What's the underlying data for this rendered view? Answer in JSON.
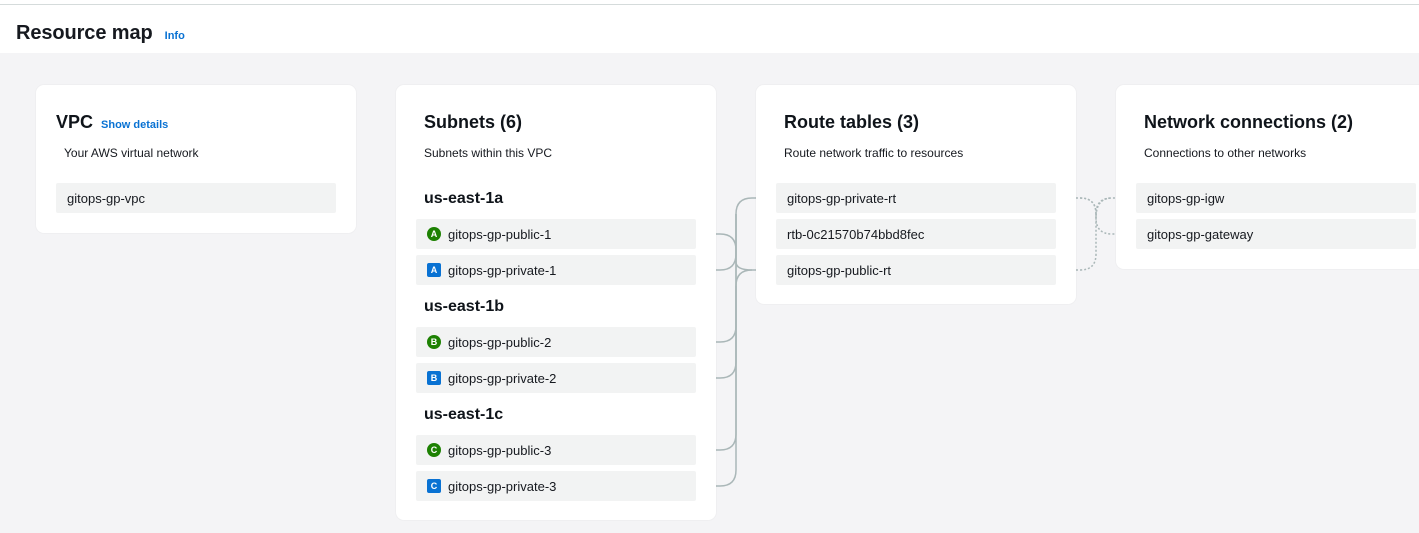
{
  "header": {
    "title": "Resource map",
    "info_label": "Info"
  },
  "vpc": {
    "title": "VPC",
    "show_details": "Show details",
    "description": "Your AWS virtual network",
    "item": "gitops-gp-vpc"
  },
  "subnets": {
    "title": "Subnets (6)",
    "description": "Subnets within this VPC",
    "zones": [
      {
        "label": "us-east-1a",
        "public": {
          "badge": "A",
          "name": "gitops-gp-public-1"
        },
        "private": {
          "badge": "A",
          "name": "gitops-gp-private-1"
        }
      },
      {
        "label": "us-east-1b",
        "public": {
          "badge": "B",
          "name": "gitops-gp-public-2"
        },
        "private": {
          "badge": "B",
          "name": "gitops-gp-private-2"
        }
      },
      {
        "label": "us-east-1c",
        "public": {
          "badge": "C",
          "name": "gitops-gp-public-3"
        },
        "private": {
          "badge": "C",
          "name": "gitops-gp-private-3"
        }
      }
    ]
  },
  "route_tables": {
    "title": "Route tables (3)",
    "description": "Route network traffic to resources",
    "items": [
      "gitops-gp-private-rt",
      "rtb-0c21570b74bbd8fec",
      "gitops-gp-public-rt"
    ]
  },
  "network_connections": {
    "title": "Network connections (2)",
    "description": "Connections to other networks",
    "items": [
      "gitops-gp-igw",
      "gitops-gp-gateway"
    ]
  },
  "colors": {
    "link": "#0972d3",
    "public_badge": "#1d8102",
    "private_badge": "#0972d3",
    "canvas_bg": "#f4f4f6",
    "item_bg": "#f2f3f3"
  }
}
